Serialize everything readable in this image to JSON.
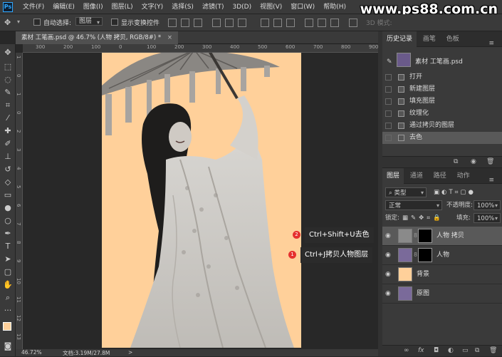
{
  "menubar": {
    "logo": "Ps",
    "items": [
      "文件(F)",
      "编辑(E)",
      "图像(I)",
      "图层(L)",
      "文字(Y)",
      "选择(S)",
      "滤镜(T)",
      "3D(D)",
      "视图(V)",
      "窗口(W)",
      "帮助(H)"
    ]
  },
  "watermark": "www.ps88.com.cn",
  "options": {
    "auto_select_label": "自动选择:",
    "auto_select_value": "图层",
    "show_transform_label": "显示变换控件",
    "mode3d_label": "3D 模式:"
  },
  "document_tab": {
    "title": "素材 工笔画.psd @ 46.7% (人物 拷贝, RGB/8#) *",
    "close": "×"
  },
  "ruler_top": [
    "300",
    "200",
    "100",
    "0",
    "100",
    "200",
    "300",
    "400",
    "500",
    "600",
    "700",
    "800",
    "900"
  ],
  "ruler_left": [
    "1",
    "0",
    "1",
    "0",
    "2",
    "3",
    "4",
    "5",
    "6",
    "7",
    "8",
    "9",
    "10",
    "11",
    "12",
    "13"
  ],
  "callouts": [
    {
      "num": "2",
      "text": "Ctrl+Shift+U去色"
    },
    {
      "num": "1",
      "text": "Ctrl+J拷贝人物图层"
    }
  ],
  "status": {
    "zoom": "46.72%",
    "doc": "文档:3.19M/27.8M",
    "arrow": ">"
  },
  "history_panel": {
    "tabs": [
      "历史记录",
      "画笔",
      "色板"
    ],
    "snapshot": "素材 工笔画.psd",
    "steps": [
      "打开",
      "新建图层",
      "填充图层",
      "纹理化",
      "通过拷贝的图层",
      "去色"
    ]
  },
  "layers_panel": {
    "tabs": [
      "图层",
      "通道",
      "路径",
      "动作"
    ],
    "filter_kind": "类型",
    "blend_mode": "正常",
    "opacity_label": "不透明度:",
    "opacity_value": "100%",
    "lock_label": "锁定:",
    "fill_label": "填充:",
    "fill_value": "100%",
    "layers": [
      {
        "name": "人物 拷贝",
        "selected": true,
        "mask": true
      },
      {
        "name": "人物",
        "selected": false,
        "mask": true
      },
      {
        "name": "背景",
        "selected": false,
        "mask": false
      },
      {
        "name": "原图",
        "selected": false,
        "mask": false
      }
    ]
  },
  "colors": {
    "canvas_bg": "#ffd09a",
    "foreground": "#ffd09a",
    "background": "#000000",
    "badge": "#e5312f"
  }
}
